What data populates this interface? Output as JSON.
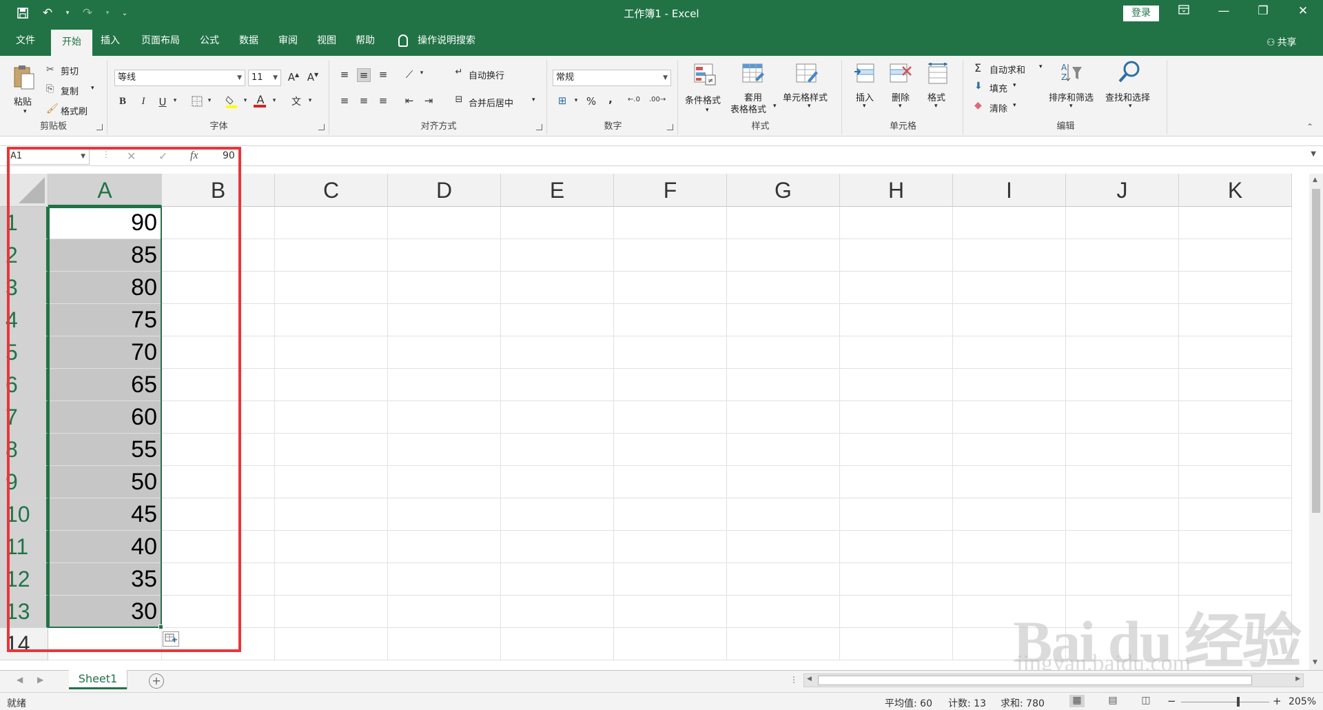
{
  "app": {
    "title": "工作簿1  -  Excel",
    "login_label": "登录"
  },
  "tabs": [
    {
      "label": "文件",
      "active": false
    },
    {
      "label": "开始",
      "active": true
    },
    {
      "label": "插入",
      "active": false
    },
    {
      "label": "页面布局",
      "active": false
    },
    {
      "label": "公式",
      "active": false
    },
    {
      "label": "数据",
      "active": false
    },
    {
      "label": "审阅",
      "active": false
    },
    {
      "label": "视图",
      "active": false
    },
    {
      "label": "帮助",
      "active": false
    }
  ],
  "tell_me": "操作说明搜索",
  "share_label": "共享",
  "ribbon": {
    "clipboard": {
      "paste": "粘贴",
      "cut": "剪切",
      "copy": "复制",
      "format_painter": "格式刷",
      "label": "剪贴板"
    },
    "font": {
      "name": "等线",
      "size": "11",
      "label": "字体"
    },
    "alignment": {
      "wrap": "自动换行",
      "merge": "合并后居中",
      "label": "对齐方式"
    },
    "number": {
      "format": "常规",
      "percent": "%",
      "comma": ",",
      "label": "数字"
    },
    "styles": {
      "conditional": "条件格式",
      "table_line1": "套用",
      "table_line2": "表格格式",
      "cell_styles": "单元格样式",
      "label": "样式"
    },
    "cells": {
      "insert": "插入",
      "delete": "删除",
      "format": "格式",
      "label": "单元格"
    },
    "editing": {
      "autosum": "自动求和",
      "fill": "填充",
      "clear": "清除",
      "sort_filter": "排序和筛选",
      "find_select": "查找和选择",
      "label": "编辑"
    }
  },
  "formula_bar": {
    "name_box": "A1",
    "value": "90",
    "fx": "fx"
  },
  "columns": [
    "A",
    "B",
    "C",
    "D",
    "E",
    "F",
    "G",
    "H",
    "I",
    "J",
    "K"
  ],
  "rows": [
    "1",
    "2",
    "3",
    "4",
    "5",
    "6",
    "7",
    "8",
    "9",
    "10",
    "11",
    "12",
    "13",
    "14"
  ],
  "cells_A": [
    "90",
    "85",
    "80",
    "75",
    "70",
    "65",
    "60",
    "55",
    "50",
    "45",
    "40",
    "35",
    "30",
    ""
  ],
  "sheet": {
    "tab_label": "Sheet1"
  },
  "status": {
    "ready": "就绪",
    "average": "平均值: 60",
    "count": "计数: 13",
    "sum": "求和: 780",
    "zoom": "205%",
    "zoom_minus": "−",
    "zoom_plus": "+"
  },
  "watermark": {
    "main": "Bai du 经验",
    "sub": "jingyan.baidu.com"
  },
  "colors": {
    "accent": "#217346",
    "highlight": "#e8363a",
    "selection": "#c6c6c6"
  }
}
